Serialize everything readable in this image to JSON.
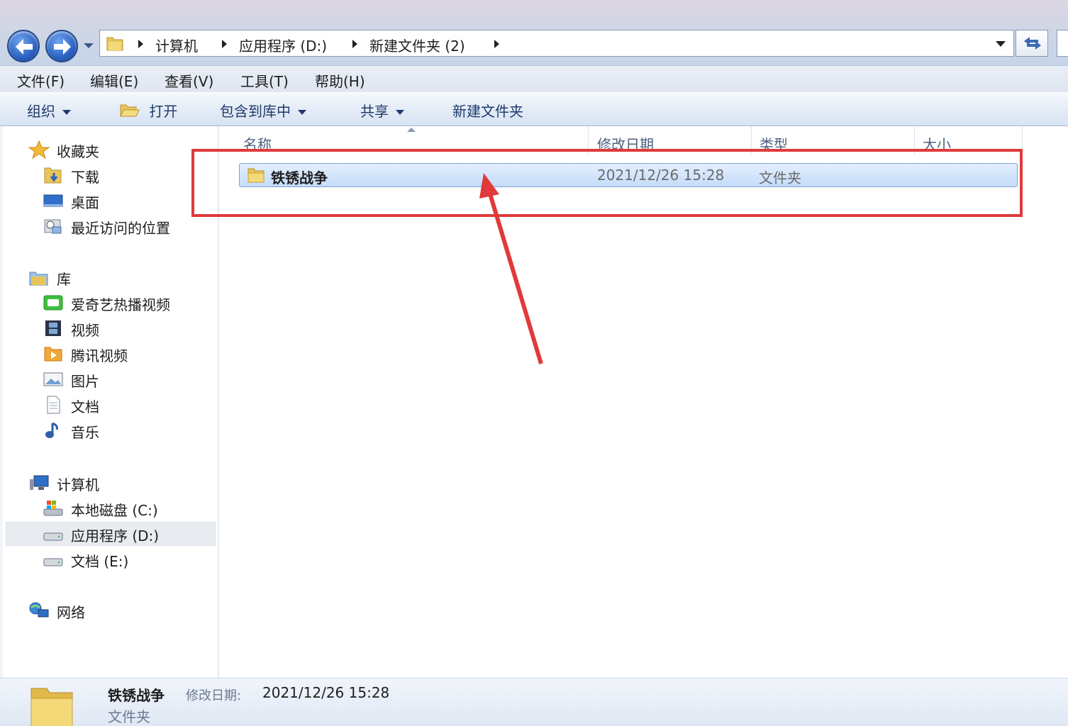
{
  "address": {
    "breadcrumbs": [
      "计算机",
      "应用程序 (D:)",
      "新建文件夹 (2)"
    ]
  },
  "menu": [
    "文件(F)",
    "编辑(E)",
    "查看(V)",
    "工具(T)",
    "帮助(H)"
  ],
  "commands": {
    "organize": "组织",
    "open": "打开",
    "include_library": "包含到库中",
    "share": "共享",
    "new_folder": "新建文件夹"
  },
  "nav": {
    "favorites": "收藏夹",
    "downloads": "下载",
    "desktop": "桌面",
    "recent": "最近访问的位置",
    "libraries": "库",
    "iqiyi": "爱奇艺热播视频",
    "videos": "视频",
    "tencent": "腾讯视频",
    "pictures": "图片",
    "documents": "文档",
    "music": "音乐",
    "computer": "计算机",
    "drive_c": "本地磁盘 (C:)",
    "drive_d": "应用程序 (D:)",
    "drive_e": "文档 (E:)",
    "network": "网络"
  },
  "columns": {
    "name": "名称",
    "modified": "修改日期",
    "type": "类型",
    "size": "大小"
  },
  "rows": [
    {
      "name": "铁锈战争",
      "modified": "2021/12/26 15:28",
      "type": "文件夹",
      "size": ""
    }
  ],
  "details": {
    "name": "铁锈战争",
    "modified_label": "修改日期:",
    "modified_value": "2021/12/26 15:28",
    "type": "文件夹"
  },
  "colors": {
    "annotation": "#e03a3a",
    "selection": "#c4dcfa"
  }
}
